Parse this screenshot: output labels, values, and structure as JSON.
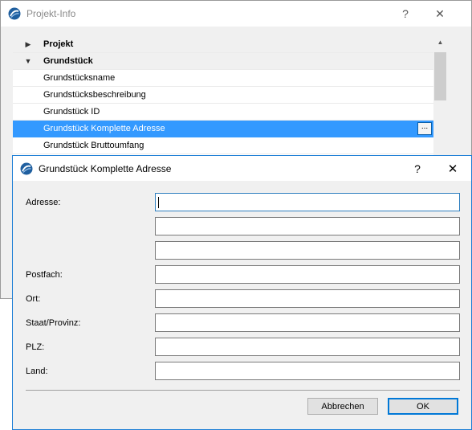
{
  "background_window": {
    "title": "Projekt-Info",
    "help_label": "?",
    "close_label": "✕",
    "tree": {
      "groups": [
        {
          "label": "Projekt",
          "expanded": false,
          "arrow": "▶"
        },
        {
          "label": "Grundstück",
          "expanded": true,
          "arrow": "▼"
        }
      ],
      "items": [
        "Grundstücksname",
        "Grundstücksbeschreibung",
        "Grundstück ID",
        "Grundstück Komplette Adresse",
        "Grundstück Bruttoumfang"
      ],
      "selected_item": "Grundstück Komplette Adresse",
      "ellipsis_label": "..."
    },
    "scroll_up_arrow": "▲"
  },
  "dialog": {
    "title": "Grundstück Komplette Adresse",
    "help_label": "?",
    "close_label": "✕",
    "fields": {
      "address_label": "Adresse:",
      "address_line1": "",
      "address_line2": "",
      "address_line3": "",
      "pobox_label": "Postfach:",
      "pobox": "",
      "city_label": "Ort:",
      "city": "",
      "state_label": "Staat/Provinz:",
      "state": "",
      "zip_label": "PLZ:",
      "zip": "",
      "country_label": "Land:",
      "country": ""
    },
    "buttons": {
      "cancel": "Abbrechen",
      "ok": "OK"
    }
  },
  "colors": {
    "selection": "#3399ff",
    "accent": "#0078d7",
    "logo": "#1f5f9f"
  }
}
